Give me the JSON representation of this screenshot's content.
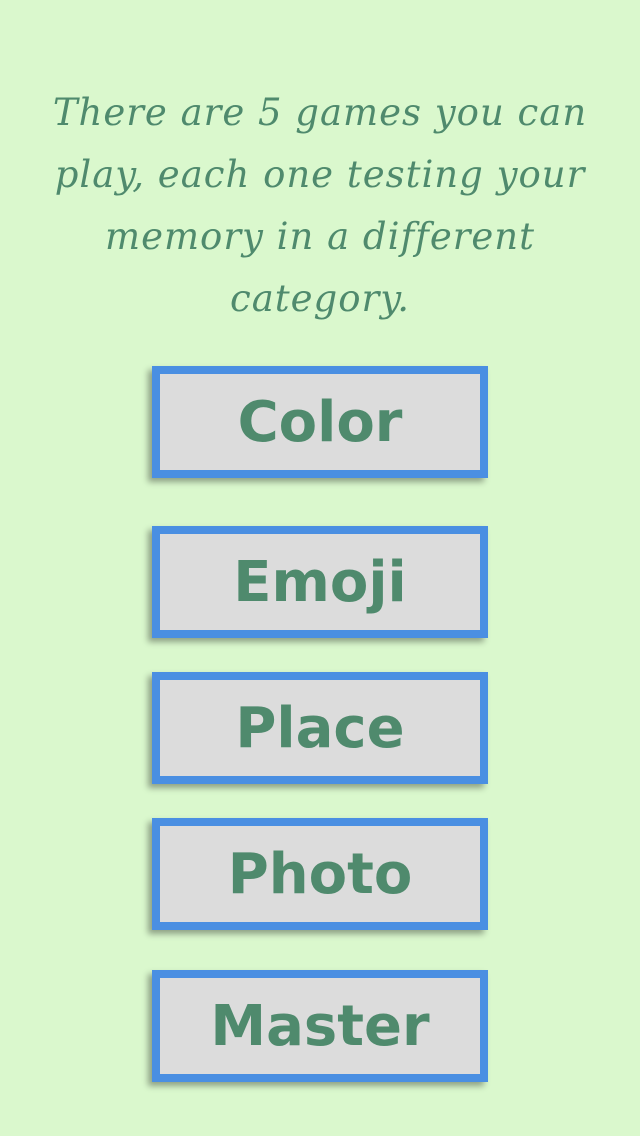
{
  "intro": {
    "text": "There are 5 games you can play, each one testing your memory in a different category."
  },
  "games": {
    "color_label": "Color",
    "emoji_label": "Emoji",
    "place_label": "Place",
    "photo_label": "Photo",
    "master_label": "Master"
  },
  "colors": {
    "background": "#daf8cd",
    "text": "#4f8a6d",
    "button_fill": "#dcdcdc",
    "button_border": "#4a8fe2"
  }
}
